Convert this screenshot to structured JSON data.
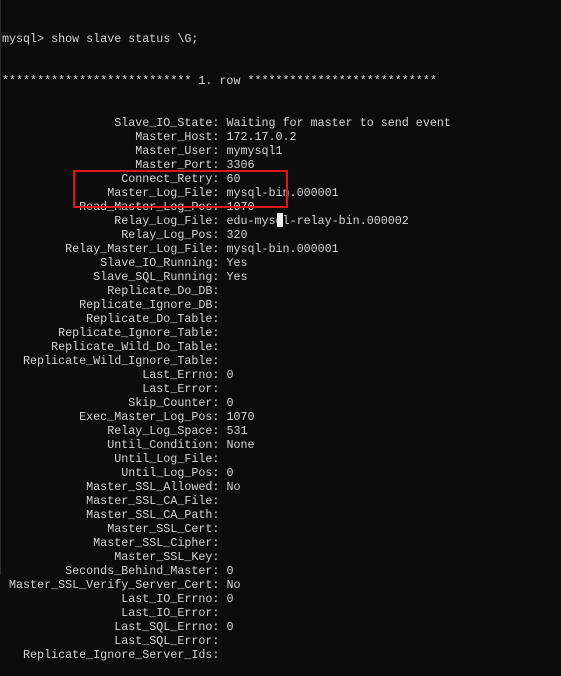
{
  "terminal": {
    "command_line": "mysql> show slave status \\G;",
    "row_header": "*************************** 1. row ***************************",
    "rows": [
      {
        "label": "Slave_IO_State",
        "value": "Waiting for master to send event"
      },
      {
        "label": "Master_Host",
        "value": "172.17.0.2"
      },
      {
        "label": "Master_User",
        "value": "mymysql1"
      },
      {
        "label": "Master_Port",
        "value": "3306"
      },
      {
        "label": "Connect_Retry",
        "value": "60"
      },
      {
        "label": "Master_Log_File",
        "value": "mysql-bin.000001"
      },
      {
        "label": "Read_Master_Log_Pos",
        "value": "1070"
      },
      {
        "label": "Relay_Log_File",
        "value": "edu-mysql-relay-bin.000002"
      },
      {
        "label": "Relay_Log_Pos",
        "value": "320"
      },
      {
        "label": "Relay_Master_Log_File",
        "value": "mysql-bin.000001"
      },
      {
        "label": "Slave_IO_Running",
        "value": "Yes"
      },
      {
        "label": "Slave_SQL_Running",
        "value": "Yes"
      },
      {
        "label": "Replicate_Do_DB",
        "value": ""
      },
      {
        "label": "Replicate_Ignore_DB",
        "value": ""
      },
      {
        "label": "Replicate_Do_Table",
        "value": ""
      },
      {
        "label": "Replicate_Ignore_Table",
        "value": ""
      },
      {
        "label": "Replicate_Wild_Do_Table",
        "value": ""
      },
      {
        "label": "Replicate_Wild_Ignore_Table",
        "value": ""
      },
      {
        "label": "Last_Errno",
        "value": "0"
      },
      {
        "label": "Last_Error",
        "value": ""
      },
      {
        "label": "Skip_Counter",
        "value": "0"
      },
      {
        "label": "Exec_Master_Log_Pos",
        "value": "1070"
      },
      {
        "label": "Relay_Log_Space",
        "value": "531"
      },
      {
        "label": "Until_Condition",
        "value": "None"
      },
      {
        "label": "Until_Log_File",
        "value": ""
      },
      {
        "label": "Until_Log_Pos",
        "value": "0"
      },
      {
        "label": "Master_SSL_Allowed",
        "value": "No"
      },
      {
        "label": "Master_SSL_CA_File",
        "value": ""
      },
      {
        "label": "Master_SSL_CA_Path",
        "value": ""
      },
      {
        "label": "Master_SSL_Cert",
        "value": ""
      },
      {
        "label": "Master_SSL_Cipher",
        "value": ""
      },
      {
        "label": "Master_SSL_Key",
        "value": ""
      },
      {
        "label": "Seconds_Behind_Master",
        "value": "0"
      },
      {
        "label": "Master_SSL_Verify_Server_Cert",
        "value": "No"
      },
      {
        "label": "Last_IO_Errno",
        "value": "0"
      },
      {
        "label": "Last_IO_Error",
        "value": ""
      },
      {
        "label": "Last_SQL_Errno",
        "value": "0"
      },
      {
        "label": "Last_SQL_Error",
        "value": ""
      },
      {
        "label": "Replicate_Ignore_Server_Ids",
        "value": ""
      }
    ]
  },
  "colors": {
    "background": "#0c0c0c",
    "text": "#d4d4d4",
    "highlight_box": "#e0161b"
  }
}
